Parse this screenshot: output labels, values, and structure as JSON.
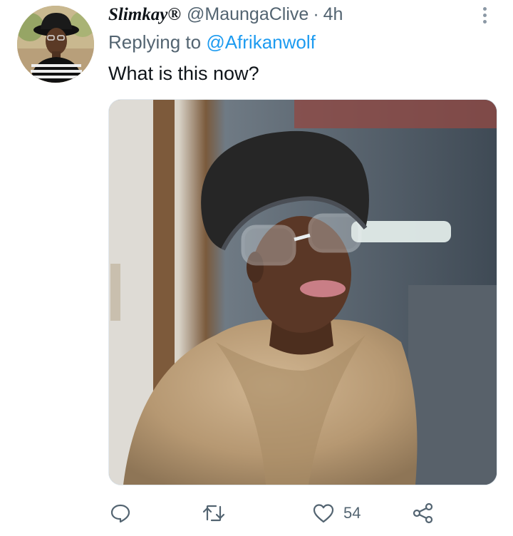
{
  "tweet": {
    "display_name": "Slimkay®",
    "handle": "@MaungaClive",
    "separator": "·",
    "time": "4h",
    "replying_prefix": "Replying to",
    "replying_to": "@Afrikanwolf",
    "text": "What is this now?",
    "icons": {
      "more": "more-vertical-icon",
      "reply": "reply-icon",
      "retweet": "retweet-icon",
      "like": "heart-icon",
      "share": "share-icon"
    },
    "likes": "54",
    "colors": {
      "link": "#1d9bf0",
      "secondary_text": "#536471",
      "icon": "#536471"
    }
  }
}
